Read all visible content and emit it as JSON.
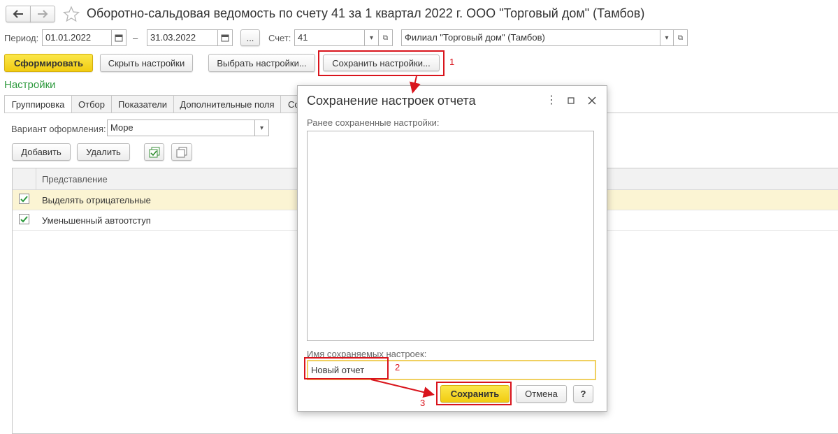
{
  "window": {
    "title": "Оборотно-сальдовая ведомость по счету 41 за 1 квартал 2022 г. ООО \"Торговый дом\" (Тамбов)"
  },
  "params": {
    "period_label": "Период:",
    "date_from": "01.01.2022",
    "dash": "–",
    "date_to": "31.03.2022",
    "ellipsis_btn": "...",
    "account_label": "Счет:",
    "account_value": "41",
    "org_value": "Филиал \"Торговый дом\" (Тамбов)"
  },
  "toolbar": {
    "form_label": "Сформировать",
    "hide_settings_label": "Скрыть настройки",
    "choose_settings_label": "Выбрать настройки...",
    "save_settings_label": "Сохранить настройки..."
  },
  "settings": {
    "heading": "Настройки",
    "tabs": [
      "Группировка",
      "Отбор",
      "Показатели",
      "Дополнительные поля",
      "Со"
    ],
    "variant_label": "Вариант оформления:",
    "variant_value": "Море",
    "add_label": "Добавить",
    "delete_label": "Удалить",
    "column_header": "Представление",
    "rows": [
      {
        "label": "Выделять отрицательные",
        "checked": true,
        "selected": true
      },
      {
        "label": "Уменьшенный автоотступ",
        "checked": true,
        "selected": false
      }
    ]
  },
  "dialog": {
    "title": "Сохранение настроек отчета",
    "saved_label": "Ранее сохраненные настройки:",
    "name_label": "Имя сохраняемых настроек:",
    "name_value": "Новый отчет",
    "save_label": "Сохранить",
    "cancel_label": "Отмена",
    "help_label": "?"
  },
  "annotations": [
    "1",
    "2",
    "3"
  ],
  "colors": {
    "accent_yellow": "#f5d423",
    "settings_green": "#2e9a3e",
    "annotation_red": "#d9141c",
    "row_highlight": "#fbf4d3"
  }
}
